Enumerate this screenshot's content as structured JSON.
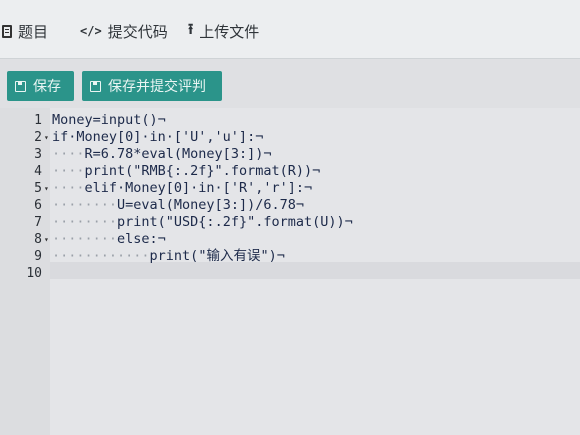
{
  "tabs": {
    "problem": "题目",
    "submit_code": "提交代码",
    "upload_file": "上传文件"
  },
  "buttons": {
    "save": "保存",
    "save_and_submit": "保存并提交评判"
  },
  "colors": {
    "accent": "#2b948a",
    "code_text": "#1d2a4a"
  },
  "editor": {
    "lines": [
      {
        "n": "1",
        "fold": "",
        "indent": "",
        "text": "Money=input()¬"
      },
      {
        "n": "2",
        "fold": "▾",
        "indent": "",
        "text": "if·Money[0]·in·['U','u']:¬"
      },
      {
        "n": "3",
        "fold": "",
        "indent": "····",
        "text": "R=6.78*eval(Money[3:])¬"
      },
      {
        "n": "4",
        "fold": "",
        "indent": "····",
        "text": "print(\"RMB{:.2f}\".format(R))¬"
      },
      {
        "n": "5",
        "fold": "▾",
        "indent": "····",
        "text": "elif·Money[0]·in·['R','r']:¬"
      },
      {
        "n": "6",
        "fold": "",
        "indent": "········",
        "text": "U=eval(Money[3:])/6.78¬"
      },
      {
        "n": "7",
        "fold": "",
        "indent": "········",
        "text": "print(\"USD{:.2f}\".format(U))¬"
      },
      {
        "n": "8",
        "fold": "▾",
        "indent": "········",
        "text": "else:¬"
      },
      {
        "n": "9",
        "fold": "",
        "indent": "············",
        "text": "print(\"输入有误\")¬"
      },
      {
        "n": "10",
        "fold": "",
        "indent": "",
        "text": ""
      }
    ]
  }
}
